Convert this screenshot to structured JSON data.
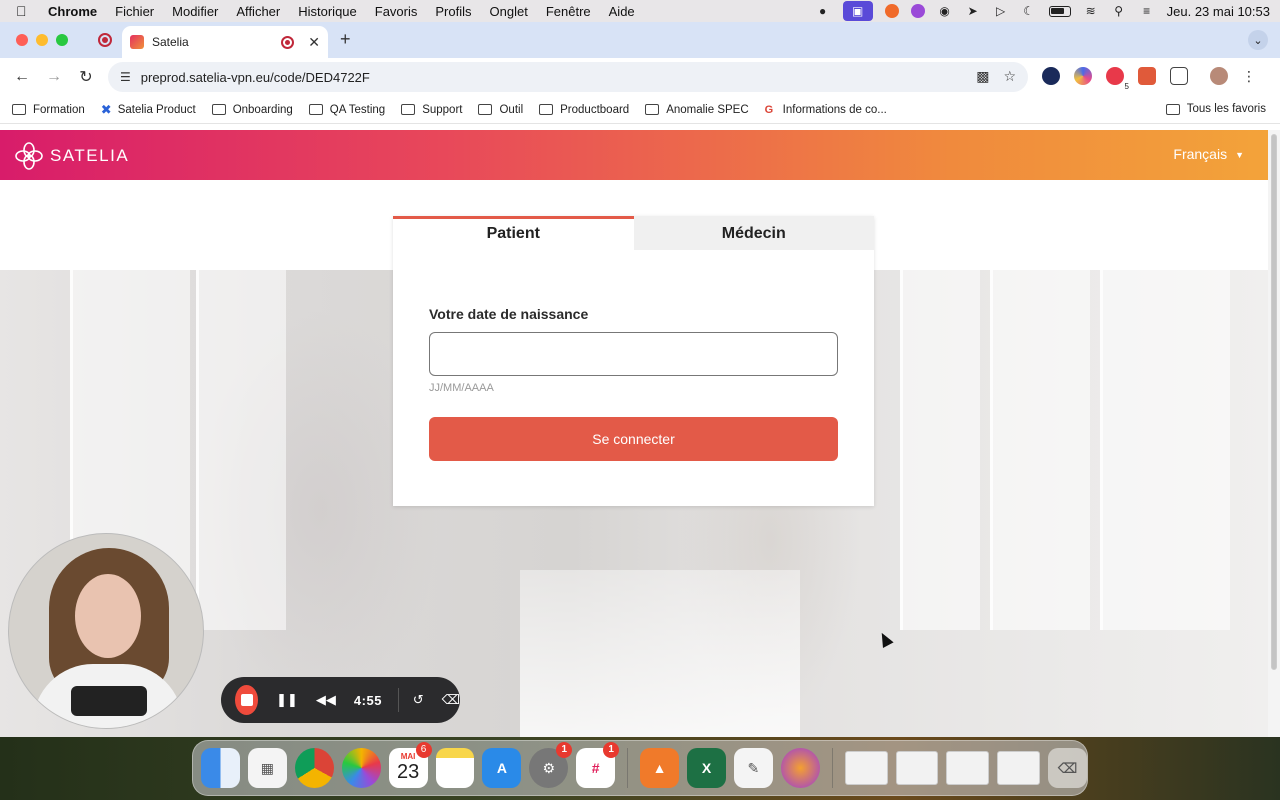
{
  "menubar": {
    "app": "Chrome",
    "items": [
      "Fichier",
      "Modifier",
      "Afficher",
      "Historique",
      "Favoris",
      "Profils",
      "Onglet",
      "Fenêtre",
      "Aide"
    ],
    "datetime": "Jeu. 23 mai  10:53"
  },
  "browser": {
    "tab_title": "Satelia",
    "url": "preprod.satelia-vpn.eu/code/DED4722F",
    "extension_badge": "5",
    "bookmarks": [
      "Formation",
      "Satelia Product",
      "Onboarding",
      "QA Testing",
      "Support",
      "Outil",
      "Productboard",
      "Anomalie SPEC",
      "Informations de co..."
    ],
    "all_bookmarks": "Tous les favoris"
  },
  "site": {
    "brand": "SATELIA",
    "language": "Français",
    "colors": {
      "accent": "#e35a48",
      "header_start": "#d81c6a",
      "header_end": "#f3a33a"
    }
  },
  "login": {
    "tabs": {
      "patient": "Patient",
      "doctor": "Médecin"
    },
    "active_tab": "Patient",
    "birthdate_label": "Votre date de naissance",
    "birthdate_value": "",
    "birthdate_hint": "JJ/MM/AAAA",
    "submit_label": "Se connecter"
  },
  "recorder": {
    "elapsed": "4:55"
  },
  "dock": {
    "calendar_month": "MAI",
    "calendar_day": "23",
    "calendar_badge": "6",
    "settings_badge": "1",
    "slack_badge": "1"
  }
}
